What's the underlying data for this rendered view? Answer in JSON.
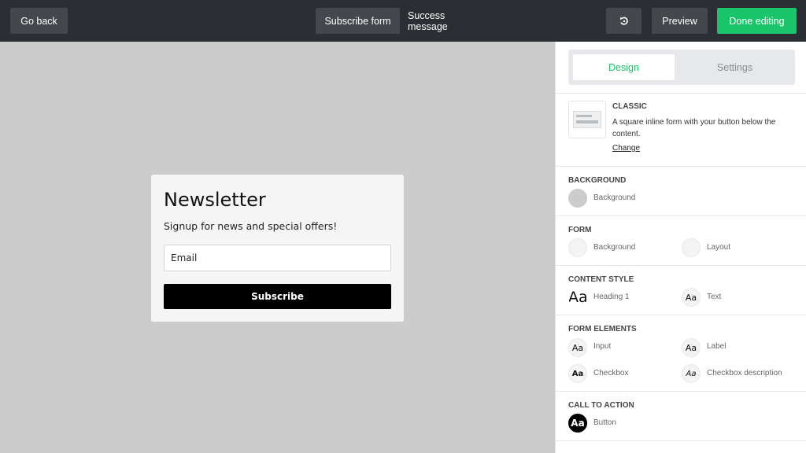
{
  "topbar": {
    "go_back": "Go back",
    "tabs": [
      {
        "label": "Subscribe form"
      },
      {
        "label": "Success message"
      }
    ],
    "undo_icon": "undo-icon",
    "preview": "Preview",
    "done": "Done editing"
  },
  "form": {
    "title": "Newsletter",
    "subtitle": "Signup for news and special offers!",
    "email_placeholder": "Email",
    "submit": "Subscribe"
  },
  "panel": {
    "tabs": [
      {
        "label": "Design"
      },
      {
        "label": "Settings"
      }
    ],
    "template": {
      "title": "CLASSIC",
      "description": "A square inline form with your button below the content.",
      "change": "Change"
    },
    "background": {
      "title": "BACKGROUND",
      "options": [
        {
          "label": "Background",
          "swatch": "#cccccc"
        }
      ]
    },
    "form_section": {
      "title": "FORM",
      "options": [
        {
          "label": "Background"
        },
        {
          "label": "Layout"
        }
      ]
    },
    "content_style": {
      "title": "CONTENT STYLE",
      "options": [
        {
          "label": "Heading 1",
          "glyph": "Aa"
        },
        {
          "label": "Text",
          "glyph": "Aa"
        }
      ]
    },
    "form_elements": {
      "title": "FORM ELEMENTS",
      "options": [
        {
          "label": "Input",
          "glyph": "Aa"
        },
        {
          "label": "Label",
          "glyph": "Aa"
        },
        {
          "label": "Checkbox",
          "glyph": "Aa"
        },
        {
          "label": "Checkbox description",
          "glyph": "Aa"
        }
      ]
    },
    "cta": {
      "title": "CALL TO ACTION",
      "options": [
        {
          "label": "Button",
          "glyph": "Aa"
        }
      ]
    }
  },
  "colors": {
    "accent": "#1ac46b",
    "topbar": "#2b2e32",
    "canvas": "#cccccc"
  }
}
